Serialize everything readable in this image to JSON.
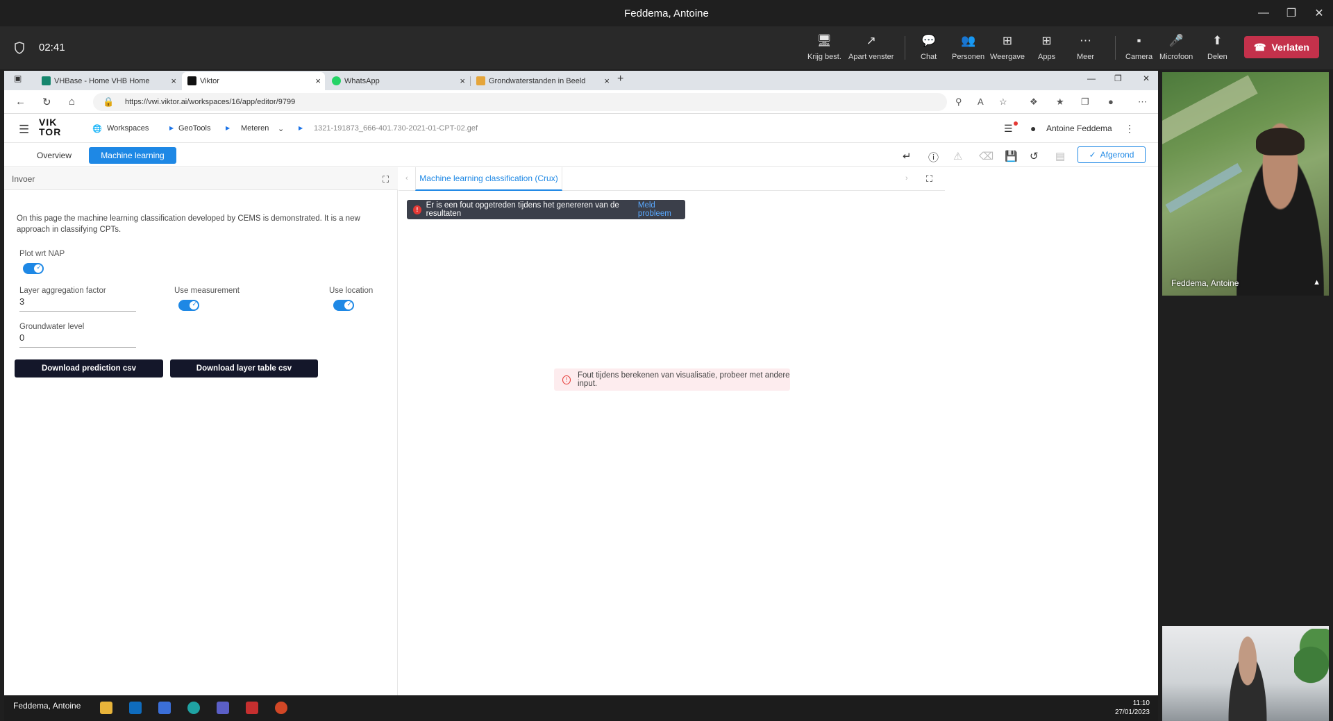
{
  "teams": {
    "window_title": "Feddema, Antoine",
    "timer": "02:41",
    "buttons": {
      "krijg": "Krijg best.",
      "apart": "Apart venster",
      "chat": "Chat",
      "personen": "Personen",
      "weergave": "Weergave",
      "apps": "Apps",
      "meer": "Meer",
      "camera": "Camera",
      "microfoon": "Microfoon",
      "delen": "Delen",
      "verlaten": "Verlaten"
    }
  },
  "browser": {
    "tabs": [
      {
        "label": "VHBase - Home VHB Home"
      },
      {
        "label": "Viktor"
      },
      {
        "label": "WhatsApp"
      },
      {
        "label": "Grondwaterstanden in Beeld"
      }
    ],
    "url": "https://vwi.viktor.ai/workspaces/16/app/editor/9799"
  },
  "app": {
    "logo_top": "VIK",
    "logo_bottom": "TOR",
    "breadcrumbs": [
      "Workspaces",
      "GeoTools",
      "Meteren",
      "1321-191873_666-401.730-2021-01-CPT-02.gef"
    ],
    "user": "Antoine Feddema",
    "tabs": {
      "overview": "Overview",
      "ml": "Machine learning"
    },
    "status_button": "Afgerond",
    "left": {
      "panel_title": "Invoer",
      "description": "On this page the machine learning classification developed by CEMS is demonstrated. It is a new approach in classifying CPTs.",
      "plot_wrt_nap": "Plot wrt NAP",
      "layer_agg_label": "Layer aggregation factor",
      "layer_agg_value": "3",
      "use_measurement": "Use measurement",
      "use_location": "Use location",
      "groundwater_label": "Groundwater level",
      "groundwater_value": "0",
      "download_prediction": "Download prediction csv",
      "download_layer": "Download layer table csv"
    },
    "right": {
      "tab_label": "Machine learning classification (Crux)",
      "error_toast": "Er is een fout opgetreden tijdens het genereren van de resultaten",
      "error_link": "Meld probleem",
      "error_box": "Fout tijdens berekenen van visualisatie, probeer met andere input."
    }
  },
  "video": {
    "main_name": "Feddema, Antoine"
  },
  "taskbar": {
    "name": "Feddema, Antoine",
    "time": "11:10",
    "date": "27/01/2023"
  }
}
